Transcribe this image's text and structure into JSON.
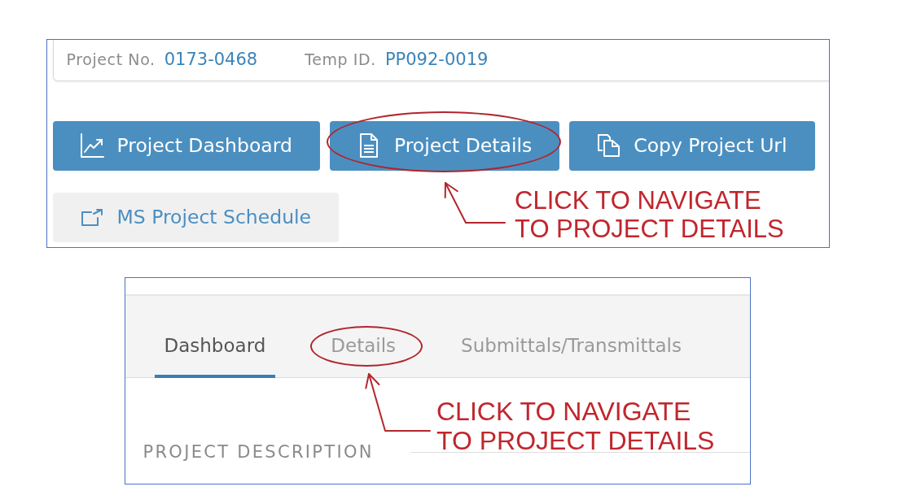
{
  "project_panel": {
    "info": [
      {
        "label": "Project No.",
        "value": "0173-0468"
      },
      {
        "label": "Temp ID.",
        "value": "PP092-0019"
      }
    ],
    "button_rows": [
      {
        "buttons": [
          {
            "label": "Project Dashboard",
            "kind": "primary",
            "circled": false
          },
          {
            "label": "Project Details",
            "kind": "primary",
            "circled": true
          },
          {
            "label": "Copy Project Url",
            "kind": "primary",
            "circled": false
          }
        ]
      },
      {
        "buttons": [
          {
            "label": "MS Project Schedule",
            "kind": "secondary",
            "circled": false
          }
        ]
      }
    ],
    "callout": {
      "lines": [
        "CLICK TO NAVIGATE",
        "TO PROJECT DETAILS"
      ]
    }
  },
  "tabs_panel": {
    "tabs": [
      {
        "label": "Dashboard",
        "selected": true,
        "circled": false
      },
      {
        "label": "Details",
        "selected": false,
        "circled": true
      },
      {
        "label": "Submittals/Transmittals",
        "selected": false,
        "circled": false
      }
    ],
    "section_title": "PROJECT DESCRIPTION",
    "callout": {
      "lines": [
        "CLICK TO NAVIGATE",
        "TO PROJECT DETAILS"
      ]
    }
  }
}
